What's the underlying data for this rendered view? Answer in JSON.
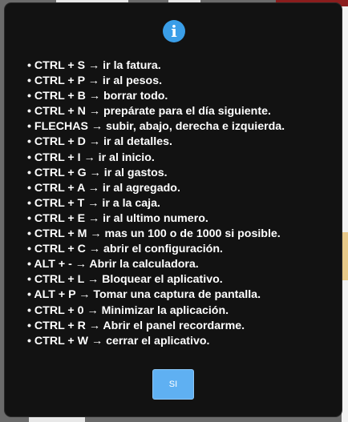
{
  "dialog": {
    "icon": "info-icon",
    "icon_glyph": "i",
    "accent_color": "#3a9ee8",
    "button_color": "#5fb0f2",
    "shortcuts": [
      "• CTRL + S → ir la fatura.",
      "• CTRL + P → ir al pesos.",
      "• CTRL + B → borrar todo.",
      "• CTRL + N → prepárate para el día siguiente.",
      "• FLECHAS → subir, abajo, derecha e izquierda.",
      "• CTRL + D → ir al detalles.",
      "• CTRL + I → ir al inicio.",
      "• CTRL + G → ir al gastos.",
      "• CTRL + A → ir al agregado.",
      "• CTRL + T → ir a la caja.",
      "• CTRL + E → ir al ultimo numero.",
      "• CTRL + M → mas un 100 o de 1000 si posible.",
      "• CTRL + C → abrir el configuración.",
      "• ALT + - → Abrir la calculadora.",
      "• CTRL + L → Bloquear el aplicativo.",
      "• ALT + P → Tomar una captura de pantalla.",
      "• CTRL + 0 → Minimizar la aplicación.",
      "• CTRL + R → Abrir el panel recordarme.",
      "• CTRL + W → cerrar el aplicativo."
    ],
    "confirm_label": "SI"
  }
}
